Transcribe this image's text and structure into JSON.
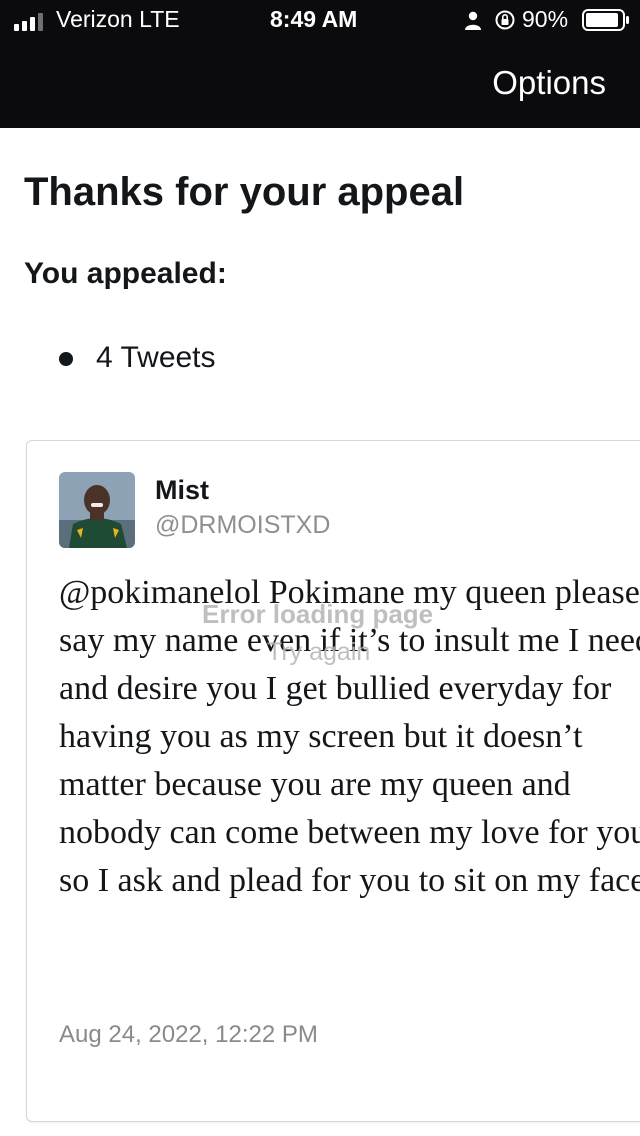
{
  "status_bar": {
    "carrier": "Verizon  LTE",
    "time": "8:49 AM",
    "battery": "90%",
    "icons": [
      "signal-icon",
      "person-icon",
      "orientation-lock-icon",
      "battery-icon"
    ],
    "signal_bars_active": 3,
    "signal_bars_total": 4,
    "battery_level": 0.9
  },
  "nav": {
    "options_label": "Options",
    "background": "#0b0b0d"
  },
  "page": {
    "title": "Thanks for your appeal",
    "subtitle": "You appealed:",
    "items": [
      "4 Tweets"
    ]
  },
  "tweet": {
    "display_name": "Mist",
    "handle": "@DRMOISTXD",
    "text": "@pokimanelol Pokimane my queen please say my name even if it’s to insult me I need and desire you I get bullied everyday for having you as my screen but it doesn’t matter because you are my queen and nobody can come between my love for you so I ask and plead for you to sit on my face",
    "timestamp": "Aug 24, 2022, 12:22 PM"
  },
  "overlay": {
    "error_text": "Error loading page",
    "retry_text": "Try again"
  },
  "colors": {
    "text_primary": "#14171a",
    "text_secondary": "#8f8f8f",
    "overlay_text": "#b5b5b5"
  }
}
